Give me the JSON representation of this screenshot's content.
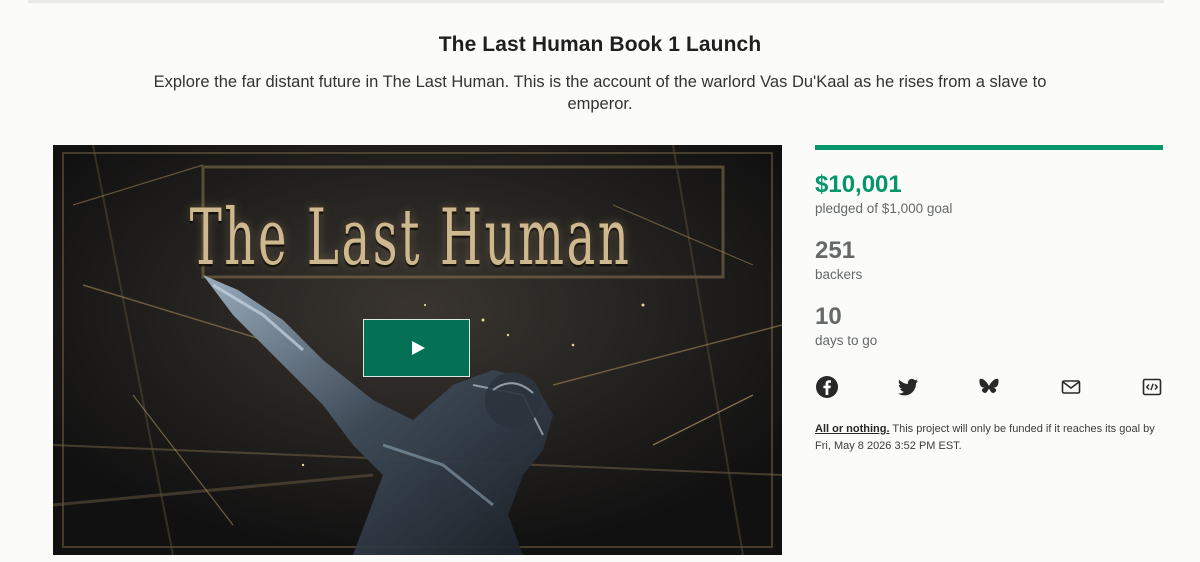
{
  "project": {
    "title": "The Last Human Book 1 Launch",
    "blurb": "Explore the far distant future in The Last Human. This is the account of the warlord Vas Du'Kaal as he rises from a slave to emperor."
  },
  "video": {
    "cover_title": "The Last Human",
    "play_icon": "play-icon"
  },
  "stats": {
    "pledged": "$10,001",
    "pledged_label": "pledged of $1,000 goal",
    "backers": "251",
    "backers_label": "backers",
    "days": "10",
    "days_label": "days to go",
    "progress_percent": 100
  },
  "share": {
    "icons": [
      "facebook-icon",
      "twitter-icon",
      "bluesky-icon",
      "mail-icon",
      "embed-icon"
    ]
  },
  "funding": {
    "link_text": "All or nothing.",
    "note": " This project will only be funded if it reaches its goal by Fri, May 8 2026 3:52 PM EST."
  },
  "colors": {
    "accent": "#05966a",
    "play_button": "#047154",
    "muted_text": "#656969"
  }
}
